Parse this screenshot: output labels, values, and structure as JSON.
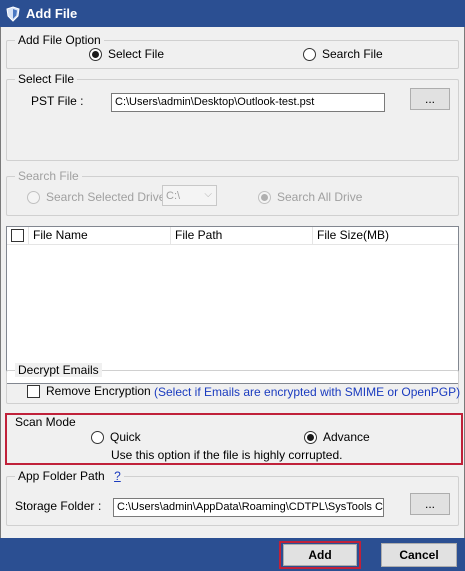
{
  "window": {
    "title": "Add File"
  },
  "add_file_option": {
    "legend": "Add File Option",
    "select_file_label": "Select File",
    "search_file_label": "Search File",
    "selected": "select_file"
  },
  "select_file": {
    "legend": "Select File",
    "pst_label": "PST File :",
    "pst_value": "C:\\Users\\admin\\Desktop\\Outlook-test.pst",
    "browse_label": "..."
  },
  "search_file": {
    "legend": "Search File",
    "selected_drive_label": "Search Selected Drive",
    "drive_value": "C:\\",
    "all_drive_label": "Search All Drive"
  },
  "file_grid": {
    "columns": [
      "File Name",
      "File Path",
      "File Size(MB)"
    ]
  },
  "decrypt": {
    "legend": "Decrypt Emails",
    "remove_label": "Remove Encryption",
    "hint": "(Select if Emails are encrypted with SMIME or OpenPGP)"
  },
  "scan_mode": {
    "legend": "Scan Mode",
    "quick_label": "Quick",
    "advance_label": "Advance",
    "selected": "advance",
    "note": "Use this option if the file is highly corrupted."
  },
  "app_folder": {
    "legend": "App Folder Path",
    "help": "?",
    "storage_label": "Storage Folder",
    "colon": ":",
    "storage_value": "C:\\Users\\admin\\AppData\\Roaming\\CDTPL\\SysTools C",
    "browse_label": "..."
  },
  "footer": {
    "add_label": "Add",
    "cancel_label": "Cancel"
  },
  "colors": {
    "title_bg": "#2b4f92",
    "highlight": "#c0213a",
    "link": "#1a3bbf"
  }
}
